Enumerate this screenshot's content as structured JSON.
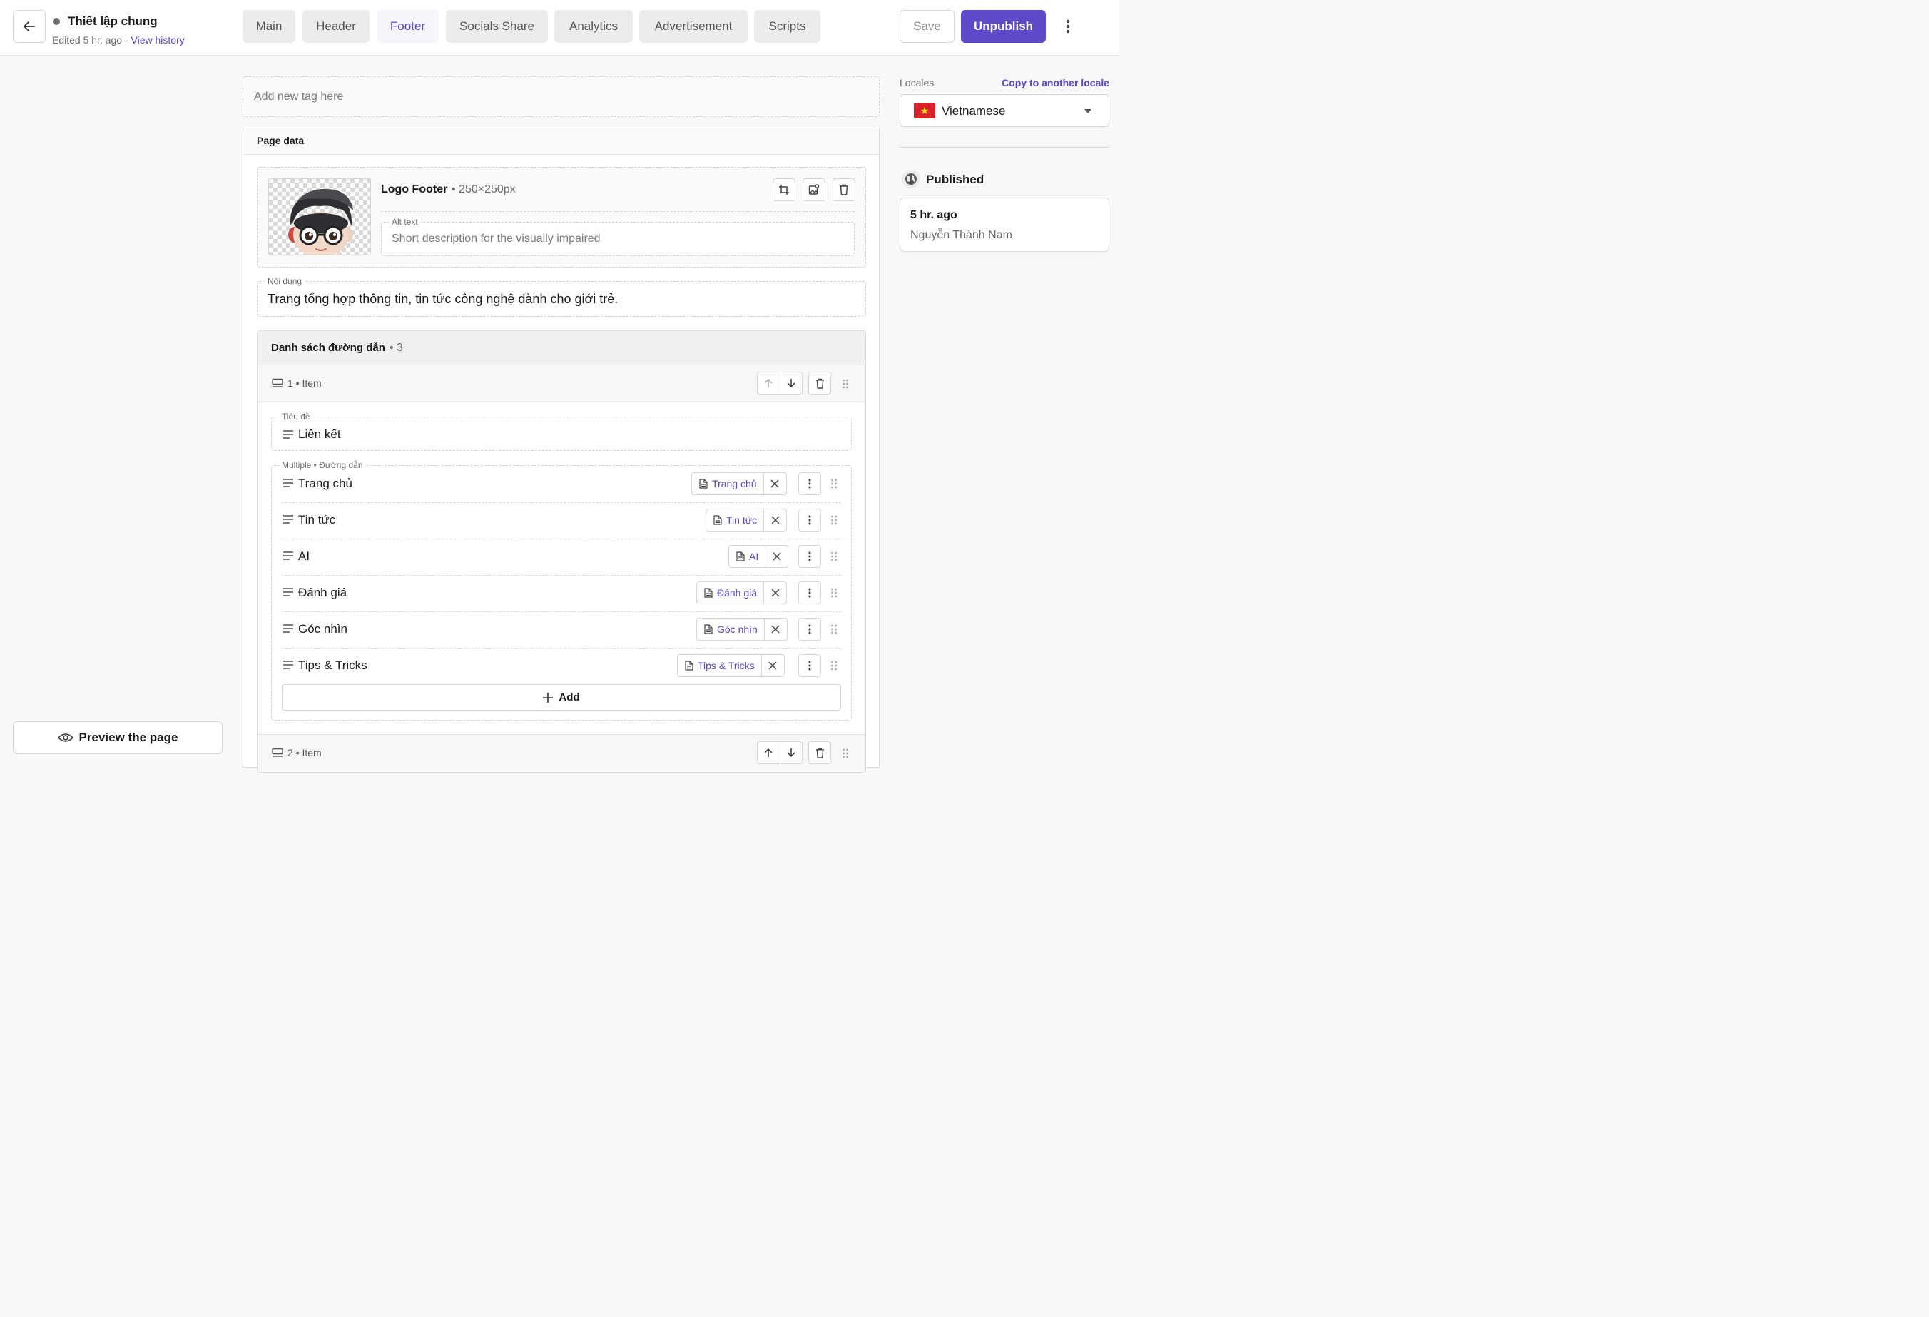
{
  "header": {
    "title": "Thiết lập chung",
    "edited": "Edited 5 hr. ago - ",
    "view_history": "View history",
    "tabs": [
      "Main",
      "Header",
      "Footer",
      "Socials Share",
      "Analytics",
      "Advertisement",
      "Scripts"
    ],
    "active_tab": "Footer",
    "save_label": "Save",
    "unpublish_label": "Unpublish"
  },
  "tag_placeholder": "Add new tag here",
  "page_data": {
    "title": "Page data",
    "logo": {
      "label": "Logo Footer",
      "size": "• 250×250px",
      "alt_label": "Alt text",
      "alt_placeholder": "Short description for the visually impaired"
    },
    "content_label": "Nội dung",
    "content_value": "Trang tổng hợp thông tin, tin tức công nghệ dành cho giới trẻ.",
    "links_list": {
      "title": "Danh sách đường dẫn",
      "count": "• 3",
      "item1_label": "1 • Item",
      "item2_label": "2 • Item",
      "title_label": "Tiêu đề",
      "title_value": "Liên kết",
      "links_label": "Multiple • Đường dẫn",
      "links": [
        {
          "text": "Trang chủ",
          "chip": "Trang chủ"
        },
        {
          "text": "Tin tức",
          "chip": "Tin tức"
        },
        {
          "text": "AI",
          "chip": "AI"
        },
        {
          "text": "Đánh giá",
          "chip": "Đánh giá"
        },
        {
          "text": "Góc nhìn",
          "chip": "Góc nhìn"
        },
        {
          "text": "Tips & Tricks",
          "chip": "Tips & Tricks"
        }
      ],
      "add_label": "Add"
    }
  },
  "sidebar": {
    "locales_label": "Locales",
    "copy_label": "Copy to another locale",
    "locale_value": "Vietnamese",
    "published_label": "Published",
    "published_time": "5 hr. ago",
    "published_user": "Nguyễn Thành Nam"
  },
  "preview_label": "Preview the page",
  "colors": {
    "accent": "#5d4ac8",
    "flag_red": "#d8222a",
    "flag_star": "#ffdd00"
  }
}
